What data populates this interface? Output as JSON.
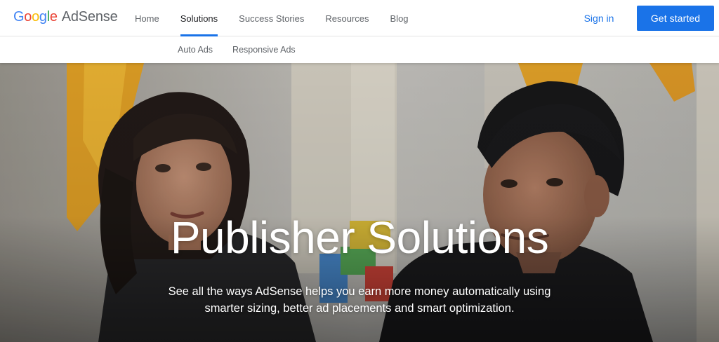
{
  "brand": {
    "google_letters": [
      {
        "char": "G",
        "color": "#4285F4"
      },
      {
        "char": "o",
        "color": "#EA4335"
      },
      {
        "char": "o",
        "color": "#FBBC05"
      },
      {
        "char": "g",
        "color": "#4285F4"
      },
      {
        "char": "l",
        "color": "#34A853"
      },
      {
        "char": "e",
        "color": "#EA4335"
      }
    ],
    "product": "AdSense"
  },
  "nav": {
    "items": [
      {
        "label": "Home",
        "active": false
      },
      {
        "label": "Solutions",
        "active": true
      },
      {
        "label": "Success Stories",
        "active": false
      },
      {
        "label": "Resources",
        "active": false
      },
      {
        "label": "Blog",
        "active": false
      }
    ],
    "sign_in": "Sign in",
    "cta": "Get started"
  },
  "subnav": {
    "items": [
      "Auto Ads",
      "Responsive Ads"
    ]
  },
  "hero": {
    "title": "Publisher Solutions",
    "subtitle": "See all the ways AdSense helps you earn more money automatically using smarter sizing, better ad placements and smart optimization.",
    "image": "two-people-interview-photo"
  },
  "colors": {
    "accent": "#1a73e8",
    "nav_text": "#5f6368",
    "active_text": "#202124"
  }
}
